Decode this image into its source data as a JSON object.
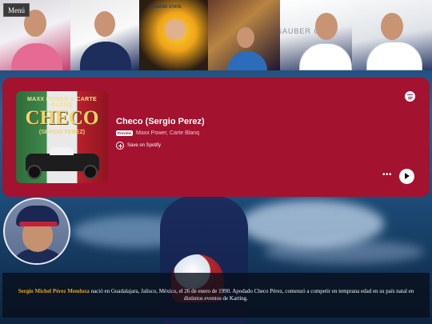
{
  "nav": {
    "menu_label": "Menú"
  },
  "gallery": {
    "photos": [
      "photo-1",
      "photo-2",
      "photo-3",
      "photo-4",
      "photo-5",
      "photo-6"
    ],
    "visible_text": [
      "QUAKER STATE",
      "SAUBER C"
    ]
  },
  "embed": {
    "accent": "#a3122f",
    "cover": {
      "artist_line": "MAXX POWER & CARTE BLANQ",
      "title": "CHECO",
      "subtitle": "(SERGIO PEREZ)"
    },
    "title": "Checo (Sergio Perez)",
    "badge": "Preview",
    "artists": "Maxx Power, Carte Blanq",
    "save_label": "Save on Spotify",
    "icons": {
      "brand": "spotify-icon",
      "more": "more-icon",
      "play": "play-icon",
      "save": "plus-circle-icon"
    }
  },
  "bio": {
    "name": "Sergio Michel Pérez Mendoza",
    "text": " nació en Guadalajara, Jalisco, México, el 26 de enero de 1990. Apodado Checo Pérez, comenzó a competir en temprana edad en su país natal en distintos eventos de Karting.",
    "highlight_color": "#e7a623"
  }
}
